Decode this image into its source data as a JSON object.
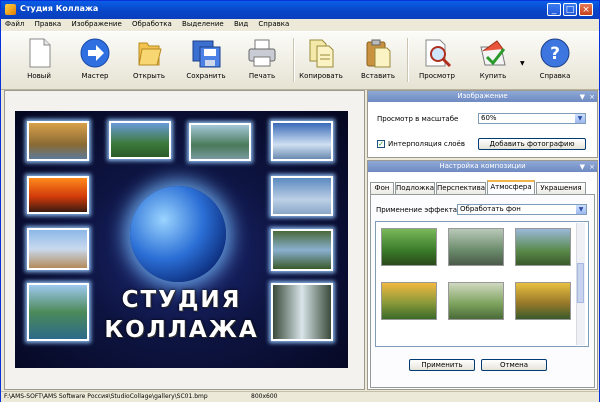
{
  "window": {
    "title": "Студия Коллажа",
    "controls": {
      "minimize": "_",
      "maximize": "□",
      "close": "×"
    }
  },
  "menu": [
    "Файл",
    "Правка",
    "Изображение",
    "Обработка",
    "Выделение",
    "Вид",
    "Справка"
  ],
  "toolbar": [
    {
      "label": "Новый",
      "icon": "new-file-icon"
    },
    {
      "label": "Мастер",
      "icon": "wizard-arrow-icon"
    },
    {
      "label": "Открыть",
      "icon": "open-folder-icon"
    },
    {
      "label": "Сохранить",
      "icon": "save-icon"
    },
    {
      "label": "Печать",
      "icon": "printer-icon"
    },
    {
      "label": "Копировать",
      "icon": "copy-icon"
    },
    {
      "label": "Вставить",
      "icon": "paste-icon"
    },
    {
      "label": "Просмотр",
      "icon": "preview-icon"
    },
    {
      "label": "Купить",
      "icon": "buy-icon"
    },
    {
      "label": "Справка",
      "icon": "help-icon"
    }
  ],
  "collage": {
    "title_line1": "СТУДИЯ",
    "title_line2": "КОЛЛАЖА"
  },
  "image_panel": {
    "header": "Изображение",
    "zoom_label": "Просмотр в масштабе",
    "zoom_value": "60%",
    "interpolation_label": "Интерполяция слоёв",
    "interpolation_checked": true,
    "add_photo_button": "Добавить фотографию"
  },
  "composition_panel": {
    "header": "Настройка композиции",
    "tabs": [
      "Фон",
      "Подложка",
      "Перспектива",
      "Атмосфера",
      "Украшения"
    ],
    "active_tab": "Атмосфера",
    "effect_label": "Применение эффекта",
    "effect_value": "Обработать фон",
    "apply_button": "Применить",
    "cancel_button": "Отмена"
  },
  "status": {
    "path": "F:\\AMS-SOFT\\AMS Software Россия\\StudioCollage\\gallery\\SC01.bmp",
    "size": "800x600"
  },
  "colors": {
    "titlebar": "#0a4fd8",
    "panel_header": "#7d97cc",
    "collage_bg": "#0d1440",
    "active_tab_accent": "#f0b44a"
  }
}
